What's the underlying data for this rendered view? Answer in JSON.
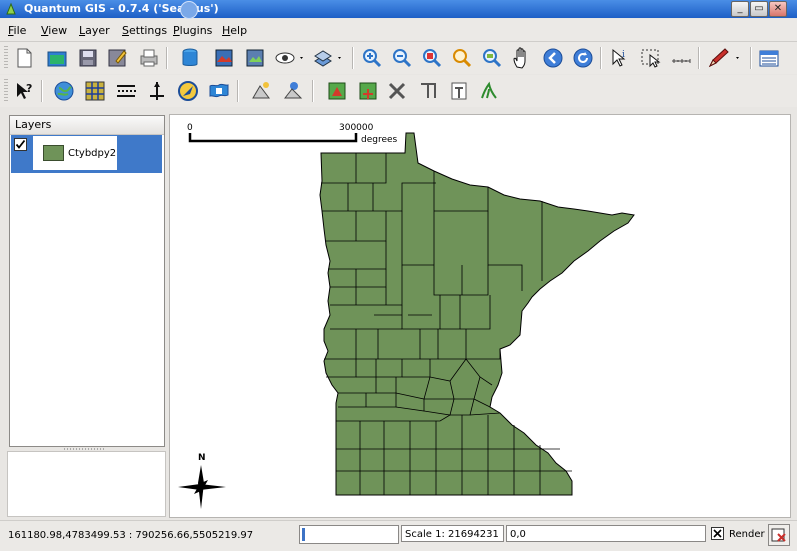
{
  "window": {
    "title": "Quantum GIS - 0.7.4 ('Seamus')",
    "buttons": [
      "_",
      "▭",
      "✕"
    ]
  },
  "menu": [
    {
      "key": "F",
      "rest": "ile"
    },
    {
      "key": "V",
      "rest": "iew"
    },
    {
      "key": "L",
      "rest": "ayer"
    },
    {
      "key": "S",
      "rest": "ettings"
    },
    {
      "key": "P",
      "rest": "lugins"
    },
    {
      "key": "H",
      "rest": "elp"
    }
  ],
  "layers_panel": {
    "title": "Layers",
    "layers": [
      {
        "name": "Ctybdpy2",
        "checked": true,
        "fill": "#6f9359"
      }
    ]
  },
  "map": {
    "scalebar_start": "0",
    "scalebar_end": "300000",
    "scalebar_units": "degrees",
    "north_label": "N",
    "fill_color": "#6f9359",
    "outline_color": "#000000"
  },
  "status": {
    "coords": "161180.98,4783499.53 : 790256.66,5505219.97",
    "scale": "Scale 1: 21694231",
    "cursor_coord": "0,0",
    "render_label": "Render",
    "render_checked": true,
    "progress": 0
  },
  "icons": {
    "file_toolbar": [
      "new-project-icon",
      "open-project-icon",
      "save-project-icon",
      "save-as-icon",
      "print-icon",
      "add-vector-layer-icon",
      "add-raster-layer-icon",
      "add-postgis-layer-icon",
      "overview-icon",
      "show-all-icon",
      "hide-all-icon",
      "zoom-in-icon",
      "zoom-out-icon",
      "zoom-full-icon",
      "zoom-selection-icon",
      "zoom-layer-icon",
      "pan-icon",
      "zoom-last-icon",
      "refresh-icon",
      "identify-icon",
      "select-icon",
      "measure-icon",
      "capture-icon",
      "attribute-table-icon"
    ],
    "second_toolbar": [
      "whats-this-icon",
      "georeferencer-icon",
      "grid-maker-icon",
      "scalebar-icon",
      "north-arrow-icon",
      "gps-icon",
      "spit-icon",
      "copyright-icon",
      "wms-icon",
      "grass-open-icon",
      "grass-edit-icon",
      "grass-tools-icon",
      "grass-region-icon",
      "grass-new-icon",
      "grass-vector-icon"
    ]
  }
}
